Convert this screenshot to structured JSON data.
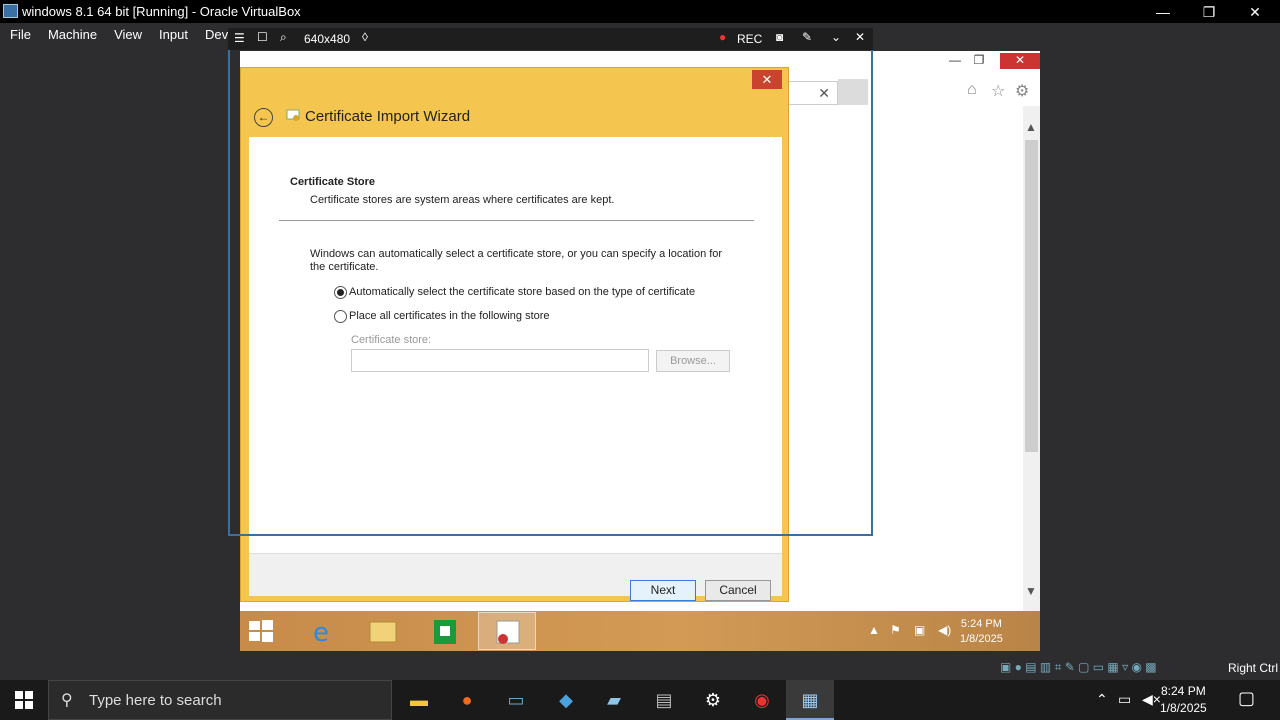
{
  "host_window": {
    "title": "windows 8.1 64 bit [Running] - Oracle VirtualBox",
    "minimize": "—",
    "restore": "❐",
    "close": "✕"
  },
  "host_menu": [
    "File",
    "Machine",
    "View",
    "Input",
    "Devices"
  ],
  "vbox_toolbar": {
    "resolution": "640x480",
    "rec_label": "REC"
  },
  "wizard": {
    "close": "✕",
    "title": "Certificate Import Wizard",
    "section_title": "Certificate Store",
    "section_desc": "Certificate stores are system areas where certificates are kept.",
    "intro": "Windows can automatically select a certificate store, or you can specify a location for the certificate.",
    "options": [
      {
        "label": "Automatically select the certificate store based on the type of certificate",
        "selected": true
      },
      {
        "label": "Place all certificates in the following store",
        "selected": false
      }
    ],
    "store_label": "Certificate store:",
    "store_value": "",
    "browse_label": "Browse...",
    "next_label": "Next",
    "cancel_label": "Cancel"
  },
  "guest_taskbar": {
    "time": "5:24 PM",
    "date": "1/8/2025"
  },
  "host_status": {
    "host_key": "Right Ctrl"
  },
  "host_taskbar": {
    "search_placeholder": "Type here to search",
    "time": "8:24 PM",
    "date": "1/8/2025"
  },
  "colors": {
    "wizard_accent": "#f5c64f",
    "guest_taskbar": "#c88b4a",
    "close_red": "#c9432e"
  }
}
